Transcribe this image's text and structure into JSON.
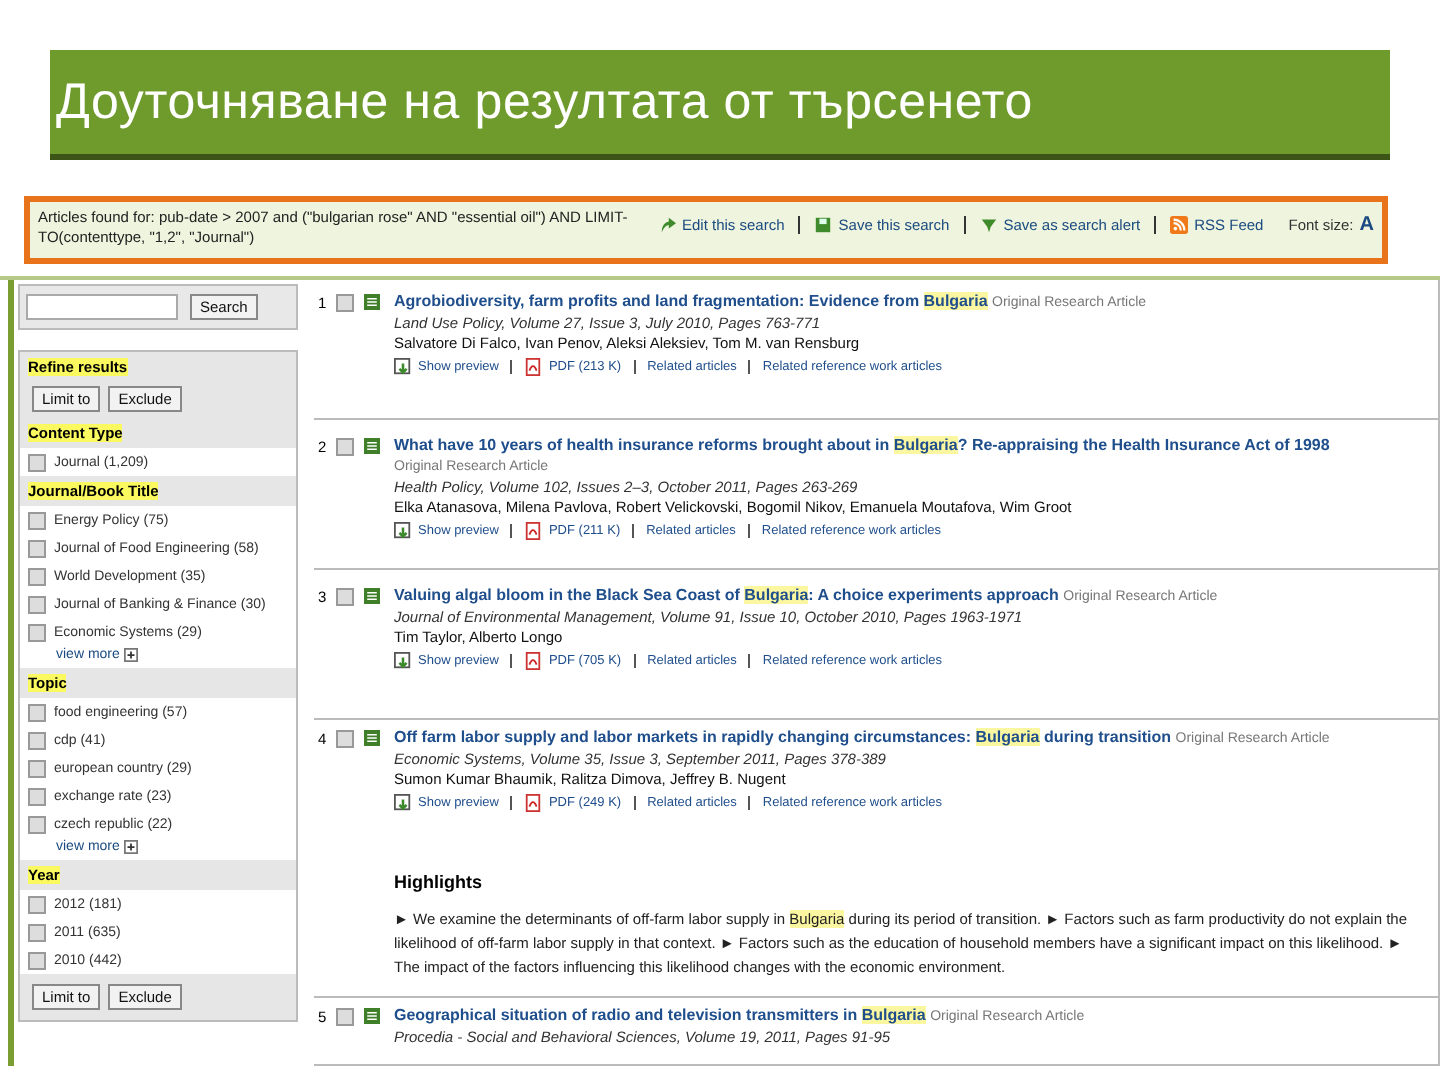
{
  "slide_title": "Доуточняване на резултата от търсенето",
  "query": {
    "text": "Articles found for: pub-date > 2007 and (\"bulgarian rose\" AND \"essential oil\") AND LIMIT-TO(contenttype, \"1,2\", \"Journal\")",
    "links": [
      {
        "label": "Edit this search",
        "kind": "edit"
      },
      {
        "label": "Save this search",
        "kind": "save"
      },
      {
        "label": "Save as search alert",
        "kind": "alert"
      },
      {
        "label": "RSS Feed",
        "kind": "rss"
      }
    ],
    "font_size_label": "Font size:",
    "font_size_glyph": "A"
  },
  "sidebar": {
    "search_button": "Search",
    "refine_title": "Refine results",
    "limit_button": "Limit to",
    "exclude_button": "Exclude",
    "sections": [
      {
        "title": "Content Type",
        "items": [
          {
            "label": "Journal (1,209)",
            "checked": false
          }
        ]
      },
      {
        "title": "Journal/Book Title",
        "view_more": "view more",
        "items": [
          {
            "label": "Energy Policy (75)",
            "checked": false
          },
          {
            "label": "Journal of Food Engineering (58)",
            "checked": false
          },
          {
            "label": "World Development (35)",
            "checked": false
          },
          {
            "label": "Journal of Banking & Finance (30)",
            "checked": false
          },
          {
            "label": "Economic Systems (29)",
            "checked": false
          }
        ]
      },
      {
        "title": "Topic",
        "view_more": "view more",
        "items": [
          {
            "label": "food engineering (57)",
            "checked": false
          },
          {
            "label": "cdp (41)",
            "checked": false
          },
          {
            "label": "european country (29)",
            "checked": false
          },
          {
            "label": "exchange rate (23)",
            "checked": false
          },
          {
            "label": "czech republic (22)",
            "checked": false
          }
        ]
      },
      {
        "title": "Year",
        "items": [
          {
            "label": "2012 (181)",
            "checked": false
          },
          {
            "label": "2011 (635)",
            "checked": false
          },
          {
            "label": "2010 (442)",
            "checked": false
          }
        ]
      }
    ],
    "bottom_limit_button": "Limit to",
    "bottom_exclude_button": "Exclude"
  },
  "results": [
    {
      "number": "1",
      "checked": false,
      "title": [
        {
          "text": "Agrobiodiversity, farm profits and land fragmentation: Evidence from ",
          "highlighted": false
        },
        {
          "text": "Bulgaria",
          "highlighted": true
        }
      ],
      "type": "Original Research Article",
      "source": "Land Use Policy, Volume 27, Issue 3, July 2010, Pages 763-771",
      "authors": "Salvatore Di Falco, Ivan Penov, Aleksi Aleksiev, Tom M. van Rensburg",
      "links": [
        {
          "label": "Show preview",
          "kind": "preview"
        },
        {
          "label": "PDF (213 K)",
          "kind": "pdf"
        },
        {
          "label": "Related articles",
          "kind": "plain"
        },
        {
          "label": "Related reference work articles",
          "kind": "plain"
        }
      ]
    },
    {
      "number": "2",
      "checked": false,
      "title": [
        {
          "text": "What have 10 years of health insurance reforms brought about in ",
          "highlighted": false
        },
        {
          "text": "Bulgaria",
          "highlighted": true
        },
        {
          "text": "? Re-appraising the Health Insurance Act of 1998",
          "highlighted": false
        }
      ],
      "type": "Original Research Article",
      "source": "Health Policy, Volume 102, Issues 2–3, October 2011, Pages 263-269",
      "authors": "Elka Atanasova, Milena Pavlova, Robert Velickovski, Bogomil Nikov, Emanuela Moutafova, Wim Groot",
      "links": [
        {
          "label": "Show preview",
          "kind": "preview"
        },
        {
          "label": "PDF (211 K)",
          "kind": "pdf"
        },
        {
          "label": "Related articles",
          "kind": "plain"
        },
        {
          "label": "Related reference work articles",
          "kind": "plain"
        }
      ]
    },
    {
      "number": "3",
      "checked": false,
      "title": [
        {
          "text": "Valuing algal bloom in the Black Sea Coast of ",
          "highlighted": false
        },
        {
          "text": "Bulgaria",
          "highlighted": true
        },
        {
          "text": ": A choice experiments approach",
          "highlighted": false
        }
      ],
      "type": "Original Research Article",
      "source": "Journal of Environmental Management, Volume 91, Issue 10, October 2010, Pages 1963-1971",
      "authors": "Tim Taylor, Alberto Longo",
      "links": [
        {
          "label": "Show preview",
          "kind": "preview"
        },
        {
          "label": "PDF (705 K)",
          "kind": "pdf"
        },
        {
          "label": "Related articles",
          "kind": "plain"
        },
        {
          "label": "Related reference work articles",
          "kind": "plain"
        }
      ]
    },
    {
      "number": "4",
      "checked": false,
      "title": [
        {
          "text": "Off farm labor supply and labor markets in rapidly changing circumstances: ",
          "highlighted": false
        },
        {
          "text": "Bulgaria",
          "highlighted": true
        },
        {
          "text": " during transition",
          "highlighted": false
        }
      ],
      "type": "Original Research Article",
      "source": "Economic Systems, Volume 35, Issue 3, September 2011, Pages 378-389",
      "authors": "Sumon Kumar Bhaumik, Ralitza Dimova, Jeffrey B. Nugent",
      "links": [
        {
          "label": "Show preview",
          "kind": "preview"
        },
        {
          "label": "PDF (249 K)",
          "kind": "pdf"
        },
        {
          "label": "Related articles",
          "kind": "plain"
        },
        {
          "label": "Related reference work articles",
          "kind": "plain"
        }
      ],
      "highlights_title": "Highlights",
      "highlights": [
        {
          "text": "► We examine the determinants of off-farm labor supply in ",
          "highlighted": false
        },
        {
          "text": "Bulgaria",
          "highlighted": true
        },
        {
          "text": " during its period of transition. ► Factors such as farm productivity do not explain the likelihood of off-farm labor supply in that context. ► Factors such as the education of household members have a significant impact on this likelihood. ► The impact of the factors influencing this likelihood changes with the economic environment.",
          "highlighted": false
        }
      ]
    },
    {
      "number": "5",
      "checked": false,
      "title": [
        {
          "text": "Geographical situation of radio and television transmitters in ",
          "highlighted": false
        },
        {
          "text": "Bulgaria",
          "highlighted": true
        }
      ],
      "type": "Original Research Article",
      "source": "Procedia - Social and Behavioral Sciences, Volume 19, 2011, Pages 91-95"
    }
  ]
}
